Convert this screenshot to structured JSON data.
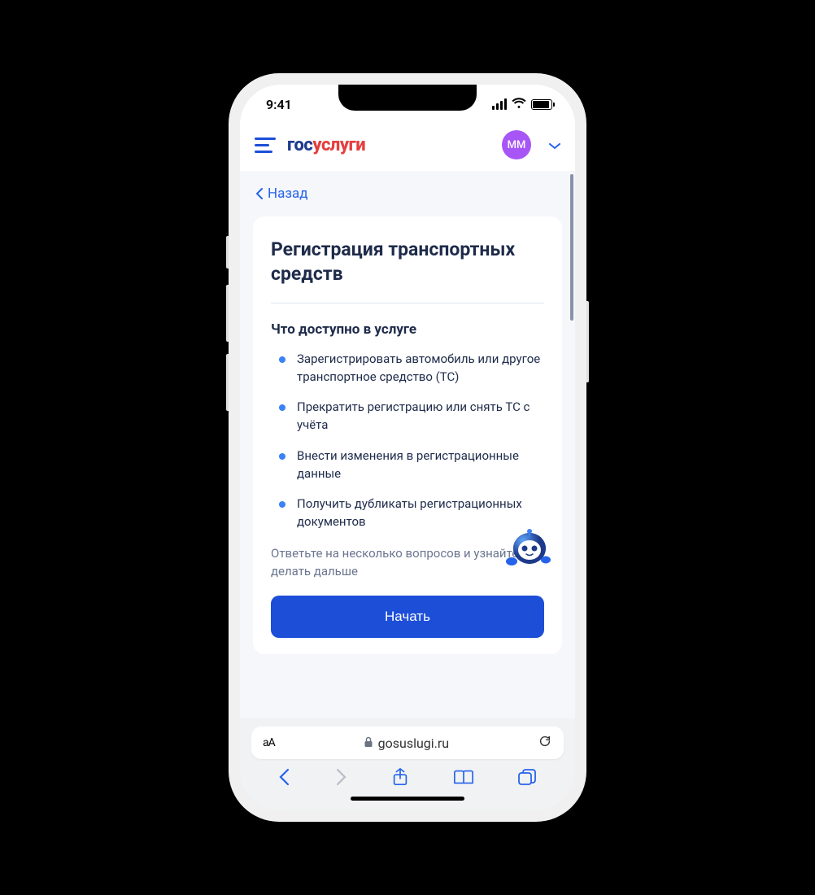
{
  "status": {
    "time": "9:41"
  },
  "header": {
    "logo_part1": "гос",
    "logo_part2": "услуги",
    "avatar_initials": "ММ"
  },
  "nav": {
    "back_label": "Назад"
  },
  "page": {
    "title": "Регистрация транспортных средств",
    "section_title": "Что доступно в услуге",
    "items": [
      "Зарегистрировать автомобиль или другое транспортное средство (ТС)",
      "Прекратить регистрацию или снять ТС с учёта",
      "Внести изменения в регистрационные данные",
      "Получить дубликаты регистрационных документов"
    ],
    "hint": "Ответьте на несколько вопросов и узнайте, что делать дальше",
    "start_button": "Начать"
  },
  "browser": {
    "text_size_label": "аА",
    "url": "gosuslugi.ru"
  }
}
